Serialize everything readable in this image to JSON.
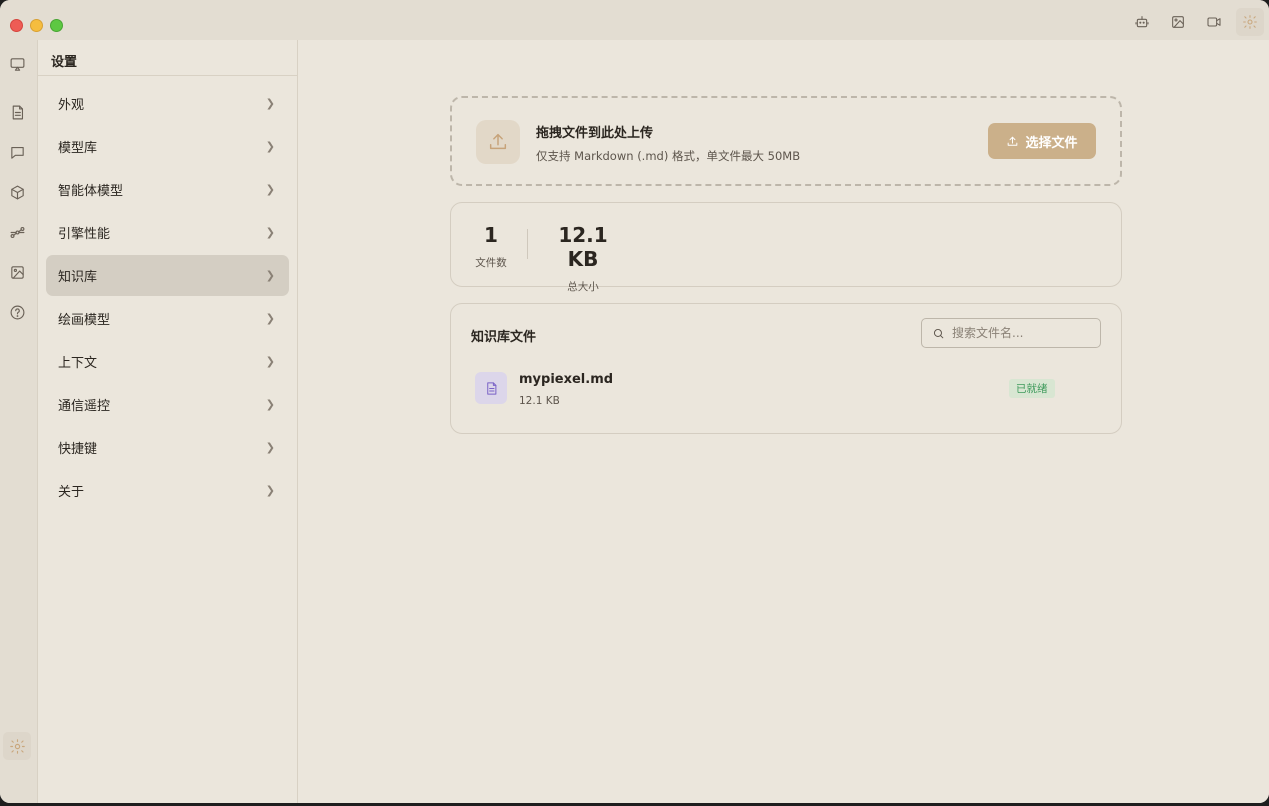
{
  "toolbar": {
    "icons": [
      "robot-icon",
      "image-icon",
      "video-icon",
      "gear-icon"
    ]
  },
  "rail": {
    "icons": [
      "screen-icon",
      "document-icon",
      "chat-icon",
      "cube-icon",
      "workflow-icon",
      "image-icon",
      "help-icon"
    ],
    "bottom_icon": "gear-icon"
  },
  "settings": {
    "title": "设置",
    "items": [
      {
        "label": "外观"
      },
      {
        "label": "模型库"
      },
      {
        "label": "智能体模型"
      },
      {
        "label": "引擎性能"
      },
      {
        "label": "知识库"
      },
      {
        "label": "绘画模型"
      },
      {
        "label": "上下文"
      },
      {
        "label": "通信遥控"
      },
      {
        "label": "快捷键"
      },
      {
        "label": "关于"
      }
    ],
    "active_index": 4
  },
  "upload": {
    "title": "拖拽文件到此处上传",
    "subtitle": "仅支持 Markdown (.md) 格式，单文件最大 50MB",
    "button_label": "选择文件"
  },
  "stats": {
    "file_count": "1",
    "file_count_label": "文件数",
    "total_size": "12.1 KB",
    "total_size_label": "总大小"
  },
  "files": {
    "title": "知识库文件",
    "search_placeholder": "搜索文件名...",
    "items": [
      {
        "name": "mypiexel.md",
        "size": "12.1 KB",
        "status": "已就绪"
      }
    ]
  },
  "colors": {
    "accent": "#cbb08a",
    "active_icon": "#c9a77d",
    "status_ready_bg": "#d8e6d2",
    "status_ready_text": "#3e9a5b",
    "file_icon": "#7a62c6"
  }
}
